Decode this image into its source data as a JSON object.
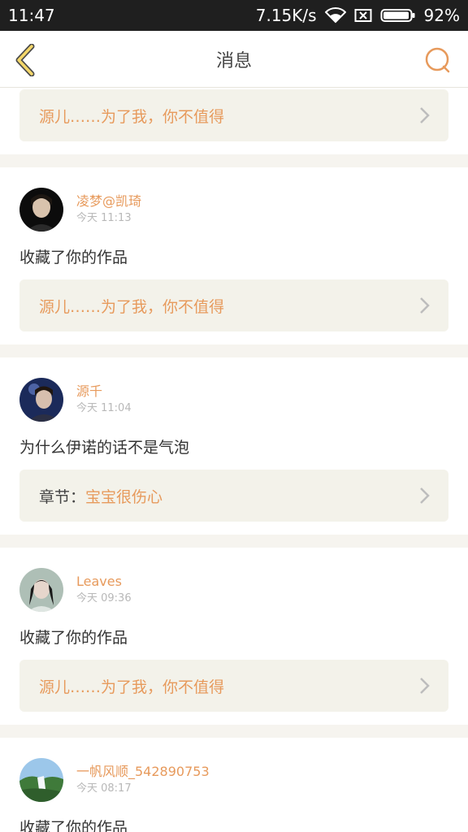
{
  "status_bar": {
    "time": "11:47",
    "speed": "7.15K/s",
    "battery": "92%",
    "icons": [
      "wifi-icon",
      "sim-missing-icon",
      "battery-icon"
    ]
  },
  "nav": {
    "title": "消息",
    "back_icon": "back-chevron-icon",
    "search_icon": "search-icon"
  },
  "colors": {
    "accent": "#e79a5c",
    "card_bg": "#ffffff",
    "link_bg": "#f3f2ea",
    "page_bg": "#f6f4ef"
  },
  "messages": [
    {
      "link_label": "源儿……为了我，你不值得"
    },
    {
      "name": "凌梦@凯琦",
      "time": "今天 11:13",
      "text": "收藏了你的作品",
      "link_label": "源儿……为了我，你不值得"
    },
    {
      "name": "源千",
      "time": "今天 11:04",
      "text": "为什么伊诺的话不是气泡",
      "link_prefix": "章节：",
      "link_label": "宝宝很伤心"
    },
    {
      "name": "Leaves",
      "time": "今天 09:36",
      "text": "收藏了你的作品",
      "link_label": "源儿……为了我，你不值得"
    },
    {
      "name": "一帆风顺_542890753",
      "time": "今天 08:17",
      "text": "收藏了你的作品"
    }
  ]
}
